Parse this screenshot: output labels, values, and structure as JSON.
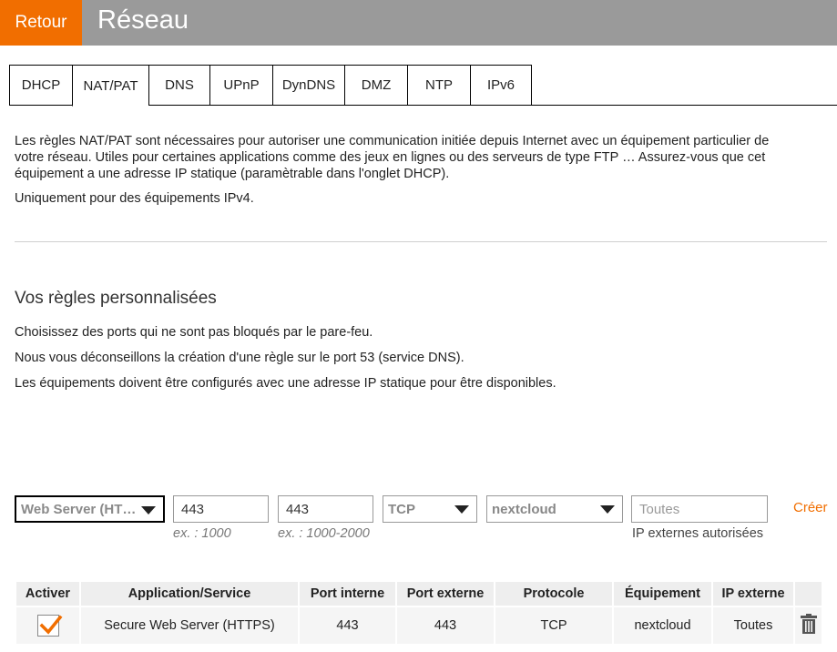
{
  "header": {
    "back_label": "Retour",
    "title": "Réseau",
    "accent_color": "#f16e00",
    "bar_color": "#9a9a9a"
  },
  "tabs": [
    {
      "label": "DHCP",
      "active": false
    },
    {
      "label": "NAT/PAT",
      "active": true
    },
    {
      "label": "DNS",
      "active": false
    },
    {
      "label": "UPnP",
      "active": false
    },
    {
      "label": "DynDNS",
      "active": false
    },
    {
      "label": "DMZ",
      "active": false
    },
    {
      "label": "NTP",
      "active": false
    },
    {
      "label": "IPv6",
      "active": false
    }
  ],
  "intro": {
    "line1": "Les règles NAT/PAT sont nécessaires pour autoriser une communication initiée depuis Internet avec un équipement particulier de",
    "line2": "votre réseau. Utiles pour certaines applications comme des jeux en lignes ou des serveurs de type FTP … Assurez-vous que cet",
    "line3": "équipement a une adresse IP statique (paramètrable dans l'onglet DHCP).",
    "ipv4_note": "Uniquement pour des équipements IPv4."
  },
  "custom_rules": {
    "title": "Vos règles personnalisées",
    "note1": "Choisissez des ports qui ne sont pas bloqués par le pare-feu.",
    "note2": "Nous vous déconseillons la création d'une règle sur le port 53 (service DNS).",
    "note3": "Les équipements doivent être configurés avec une adresse IP statique pour être disponibles."
  },
  "form": {
    "service_value": "Web Server (HT…",
    "internal_port_value": "443",
    "internal_port_hint": "ex. : 1000",
    "external_port_value": "443",
    "external_port_hint": "ex. : 1000-2000",
    "protocol_value": "TCP",
    "device_value": "nextcloud",
    "external_ip_placeholder": "Toutes",
    "external_ip_label": "IP externes autorisées",
    "create_label": "Créer"
  },
  "table": {
    "headers": [
      "Activer",
      "Application/Service",
      "Port interne",
      "Port externe",
      "Protocole",
      "Équipement",
      "IP externe",
      ""
    ],
    "rows": [
      {
        "enabled": true,
        "service": "Secure Web Server (HTTPS)",
        "internal_port": "443",
        "external_port": "443",
        "protocol": "TCP",
        "device": "nextcloud",
        "external_ip": "Toutes",
        "delete_icon": "trash-icon"
      }
    ]
  }
}
